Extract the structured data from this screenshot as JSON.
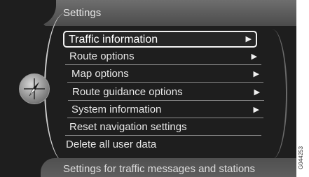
{
  "header": {
    "title": "Settings"
  },
  "menu": {
    "items": [
      {
        "label": "Traffic information",
        "has_arrow": true,
        "selected": true
      },
      {
        "label": "Route options",
        "has_arrow": true,
        "selected": false
      },
      {
        "label": "Map options",
        "has_arrow": true,
        "selected": false
      },
      {
        "label": "Route guidance options",
        "has_arrow": true,
        "selected": false
      },
      {
        "label": "System information",
        "has_arrow": true,
        "selected": false
      },
      {
        "label": "Reset navigation settings",
        "has_arrow": false,
        "selected": false
      },
      {
        "label": "Delete all user data",
        "has_arrow": false,
        "selected": false
      }
    ],
    "arrow_glyph": "▶"
  },
  "footer": {
    "help_text": "Settings for traffic messages and stations"
  },
  "icons": {
    "left": "compass-icon"
  },
  "watermark": "G044253",
  "colors": {
    "background": "#1e1e1e",
    "bar": "#5a5a5a",
    "text": "#e8e8e8",
    "highlight_border": "#f2f2f2"
  }
}
